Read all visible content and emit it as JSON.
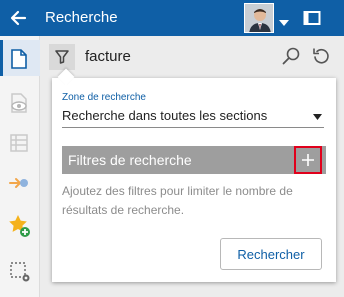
{
  "header": {
    "title": "Recherche"
  },
  "search": {
    "query": "facture"
  },
  "panel": {
    "zone_label": "Zone de recherche",
    "zone_value": "Recherche dans toutes les sections",
    "filters_title": "Filtres de recherche",
    "filters_help": "Ajoutez des filtres pour limiter le nombre de résultats de recherche.",
    "search_button": "Rechercher"
  },
  "colors": {
    "brand": "#0f5fa6",
    "highlight": "#e0001b",
    "filters_bar": "#9e9e9e"
  },
  "icons": [
    "back-arrow-icon",
    "user-avatar",
    "caret-down-icon",
    "window-icon",
    "document-icon",
    "eye-icon",
    "list-icon",
    "link-icon",
    "star-add-icon",
    "selection-settings-icon",
    "filter-icon",
    "search-icon",
    "reset-icon",
    "plus-icon"
  ]
}
